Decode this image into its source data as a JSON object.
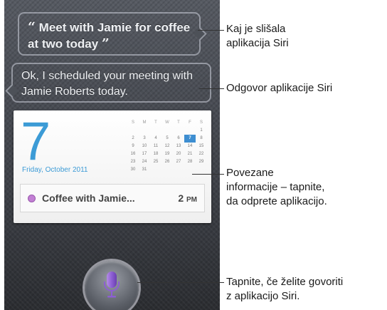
{
  "user_request": {
    "open_quote": "“",
    "text": "Meet with Jamie for coffee at two today",
    "close_quote": "”"
  },
  "siri_response": "Ok, I scheduled your meeting with Jamie Roberts today.",
  "calendar_card": {
    "day_number": "7",
    "date_label": "Friday, October 2011",
    "weekday_headers": [
      "S",
      "M",
      "T",
      "W",
      "T",
      "F",
      "S"
    ],
    "weeks": [
      [
        "",
        "",
        "",
        "",
        "",
        "",
        "1"
      ],
      [
        "2",
        "3",
        "4",
        "5",
        "6",
        "7",
        "8"
      ],
      [
        "9",
        "10",
        "11",
        "12",
        "13",
        "14",
        "15"
      ],
      [
        "16",
        "17",
        "18",
        "19",
        "20",
        "21",
        "22"
      ],
      [
        "23",
        "24",
        "25",
        "26",
        "27",
        "28",
        "29"
      ],
      [
        "30",
        "31",
        "",
        "",
        "",
        "",
        ""
      ]
    ],
    "selected_day": "7",
    "event": {
      "title": "Coffee with Jamie...",
      "time": "2",
      "meridiem": "PM",
      "color": "#c27fd4"
    }
  },
  "callouts": {
    "request": [
      "Kaj je slišala",
      "aplikacija Siri"
    ],
    "response": [
      "Odgovor aplikacije Siri"
    ],
    "info": [
      "Povezane",
      "informacije – tapnite,",
      "da odprete aplikacijo."
    ],
    "mic": [
      "Tapnite, če želite govoriti",
      "z aplikacijo Siri."
    ]
  },
  "icons": {
    "mic_button": "microphone-icon"
  },
  "colors": {
    "date_blue": "#3c9bd6",
    "selected_day": "#3d8ed1",
    "mic_purple": "#8d5fd3"
  }
}
